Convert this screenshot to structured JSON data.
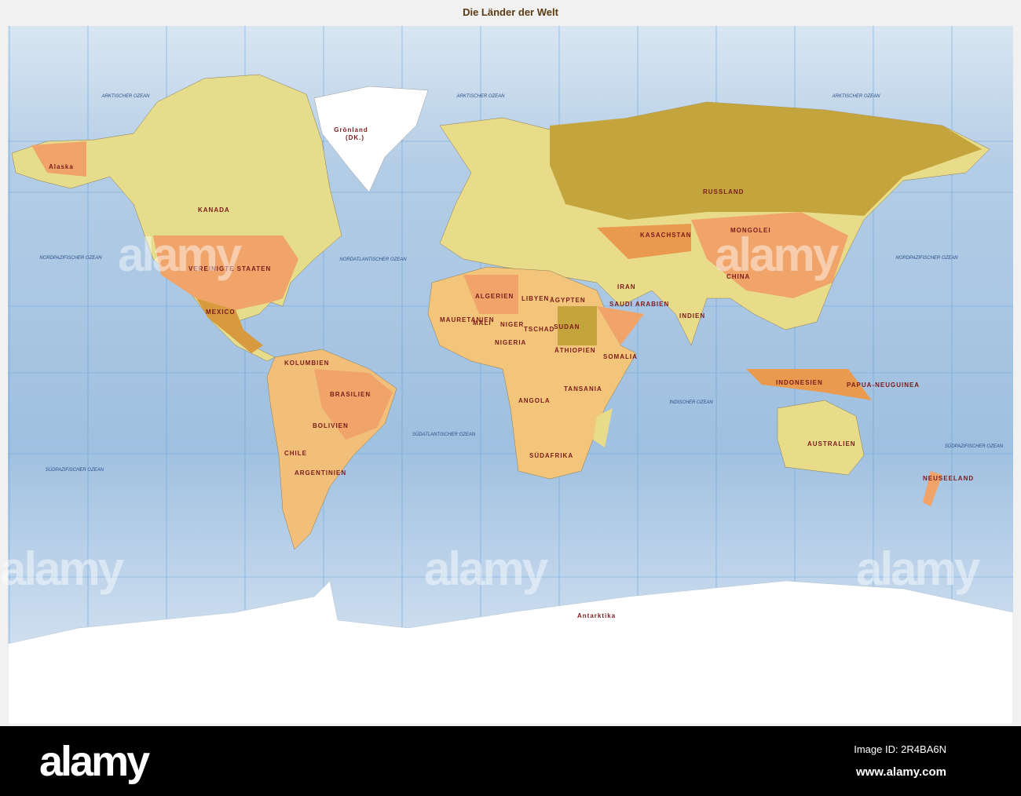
{
  "title": "Die Länder der Welt",
  "countries": [
    {
      "name": "Grönland",
      "note": "(DK.)"
    },
    {
      "name": "KANADA"
    },
    {
      "name": "VEREINIGTE STAATEN"
    },
    {
      "name": "MEXICO"
    },
    {
      "name": "Alaska"
    },
    {
      "name": "BRASILIEN"
    },
    {
      "name": "KOLUMBIEN"
    },
    {
      "name": "BOLIVIEN"
    },
    {
      "name": "ARGENTINIEN"
    },
    {
      "name": "CHILE"
    },
    {
      "name": "ALGERIEN"
    },
    {
      "name": "LIBYEN"
    },
    {
      "name": "ÄGYPTEN"
    },
    {
      "name": "MALI"
    },
    {
      "name": "NIGER"
    },
    {
      "name": "TSCHAD"
    },
    {
      "name": "SUDAN"
    },
    {
      "name": "NIGERIA"
    },
    {
      "name": "ÄTHIOPIEN"
    },
    {
      "name": "SOMALIA"
    },
    {
      "name": "TANSANIA"
    },
    {
      "name": "ANGOLA"
    },
    {
      "name": "SÜDAFRIKA"
    },
    {
      "name": "MAURETANIEN"
    },
    {
      "name": "SAUDI ARABIEN"
    },
    {
      "name": "RUSSLAND"
    },
    {
      "name": "KASACHSTAN"
    },
    {
      "name": "MONGOLEI"
    },
    {
      "name": "CHINA"
    },
    {
      "name": "IRAN"
    },
    {
      "name": "INDIEN"
    },
    {
      "name": "INDONESIEN"
    },
    {
      "name": "PAPUA-NEUGUINEA"
    },
    {
      "name": "AUSTRALIEN"
    },
    {
      "name": "NEUSEELAND"
    },
    {
      "name": "Antarktika"
    }
  ],
  "oceans": [
    "ARKTISCHER OZEAN",
    "ARKTISCHER OZEAN",
    "ARKTISCHER OZEAN",
    "NORDPAZIFISCHER OZEAN",
    "NORDATLANTISCHER OZEAN",
    "NORDPAZIFISCHER OZEAN",
    "SÜDATLANTISCHER OZEAN",
    "INDISCHER OZEAN",
    "SÜDPAZIFISCHER OZEAN",
    "SÜDPAZIFISCHER OZEAN"
  ],
  "watermark": "alamy",
  "footer": {
    "logo": "alamy",
    "image_id": "Image ID: 2R4BA6N",
    "site": "www.alamy.com"
  },
  "colors": {
    "ocean": "#a9c8e4",
    "russia": "#c4a43c",
    "orange": "#f0a46a",
    "yellow": "#e8dc8a",
    "ice": "#ffffff"
  }
}
